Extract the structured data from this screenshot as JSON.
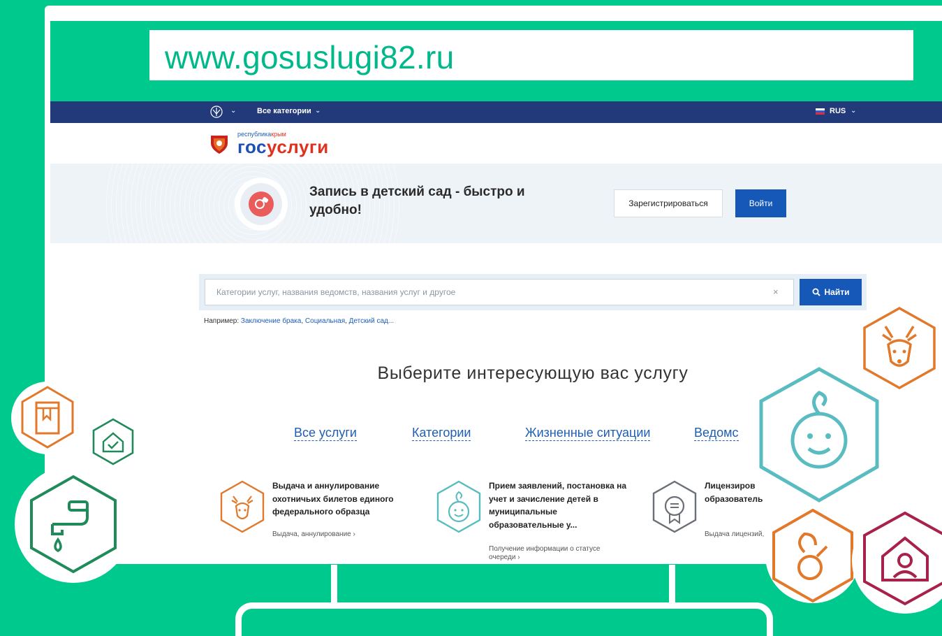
{
  "url": "www.gosuslugi82.ru",
  "topbar": {
    "all_categories": "Все категории",
    "language": "RUS"
  },
  "logo": {
    "small_prefix": "республика",
    "small_suffix": "крым",
    "big_left": "гос",
    "big_right": "услуги"
  },
  "banner": {
    "title": "Запись в детский сад - быстро и удобно!",
    "register_label": "Зарегистрироваться",
    "login_label": "Войти"
  },
  "search": {
    "placeholder": "Категории услуг, названия ведомств, названия услуг и другое",
    "button_label": "Найти",
    "clear_symbol": "×",
    "example_prefix": "Например:",
    "examples": [
      "Заключение брака",
      "Социальная",
      "Детский сад..."
    ]
  },
  "services": {
    "heading": "Выберите интересующую вас услугу",
    "tabs": [
      "Все услуги",
      "Категории",
      "Жизненные ситуации",
      "Ведомс"
    ],
    "cards": [
      {
        "title": "Выдача и аннулирование охотничьих билетов единого федерального образца",
        "sub": "Выдача, аннулирование ›",
        "icon": "deer-icon"
      },
      {
        "title": "Прием заявлений, постановка на учет и зачисление детей в муниципальные образовательные у...",
        "sub": "Получение информации о статусе очереди ›",
        "icon": "child-icon"
      },
      {
        "title": "Лицензиров образователь",
        "sub": "Выдача лицензий,",
        "icon": "certificate-icon"
      }
    ]
  },
  "colors": {
    "background": "#00c98d",
    "topbar": "#223a7a",
    "primary_button": "#1558b7",
    "link": "#1e5eb5",
    "orange": "#e2782a",
    "teal": "#58bcc0",
    "green": "#1f8a5a",
    "crimson": "#a8214a"
  }
}
